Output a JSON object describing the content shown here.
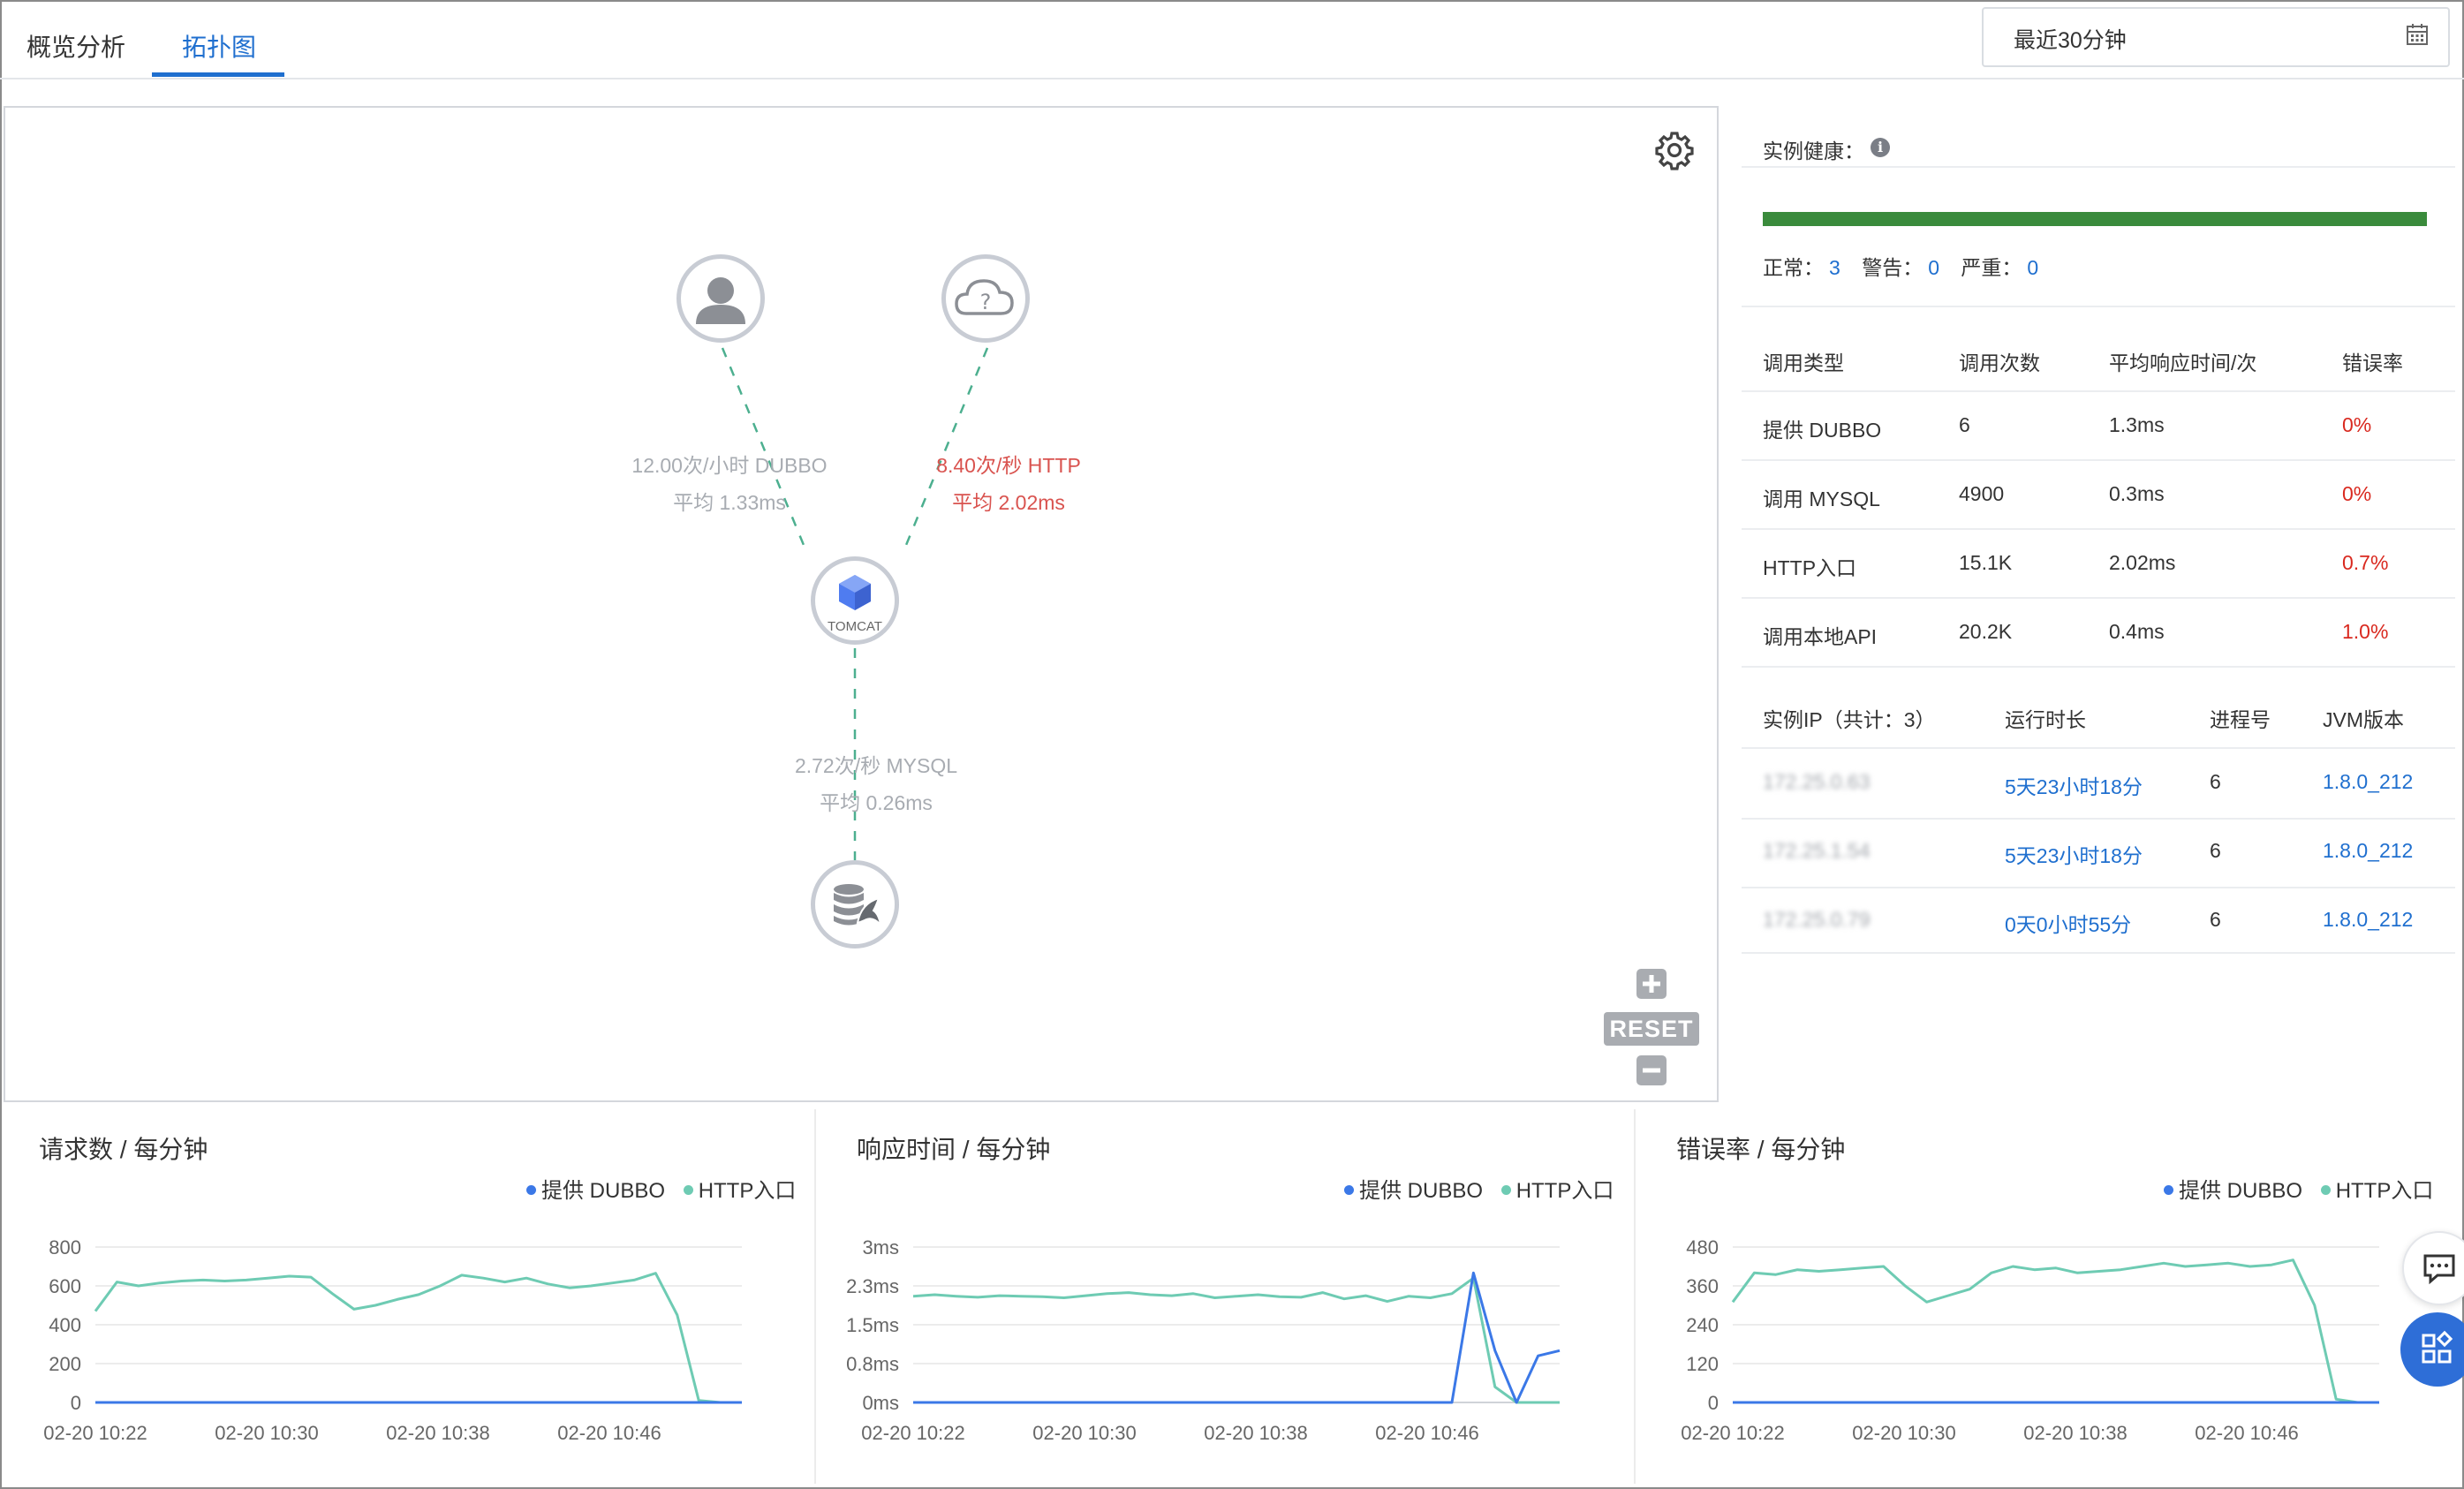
{
  "tabs": [
    {
      "label": "概览分析",
      "active": false
    },
    {
      "label": "拓扑图",
      "active": true
    }
  ],
  "time_range": {
    "value": "最近30分钟",
    "icon": "calendar-icon"
  },
  "topology": {
    "nodes": [
      {
        "name": "user",
        "icon": "user-icon"
      },
      {
        "name": "external-http",
        "icon": "cloud-question-icon"
      },
      {
        "name": "tomcat",
        "icon": "cube-icon",
        "label": "TOMCAT"
      },
      {
        "name": "mysql",
        "icon": "database-icon"
      }
    ],
    "edges": [
      {
        "line1": "12.00次/小时 DUBBO",
        "line2": "平均 1.33ms",
        "color": "#a8acb2"
      },
      {
        "line1": "8.40次/秒 HTTP",
        "line2": "平均 2.02ms",
        "color": "#d9534f"
      },
      {
        "line1": "2.72次/秒 MYSQL",
        "line2": "平均 0.26ms",
        "color": "#a8acb2"
      }
    ],
    "reset_label": "RESET"
  },
  "health": {
    "title": "实例健康：",
    "normal_label": "正常：",
    "normal": "3",
    "warning_label": "警告：",
    "warning": "0",
    "critical_label": "严重：",
    "critical": "0",
    "bar_color": "#3a8b3c"
  },
  "call_table": {
    "headers": [
      "调用类型",
      "调用次数",
      "平均响应时间/次",
      "错误率"
    ],
    "rows": [
      [
        "提供 DUBBO",
        "6",
        "1.3ms",
        "0%"
      ],
      [
        "调用 MYSQL",
        "4900",
        "0.3ms",
        "0%"
      ],
      [
        "HTTP入口",
        "15.1K",
        "2.02ms",
        "0.7%"
      ],
      [
        "调用本地API",
        "20.2K",
        "0.4ms",
        "1.0%"
      ]
    ]
  },
  "instance_table": {
    "headers": [
      "实例IP（共计：3）",
      "运行时长",
      "进程号",
      "JVM版本"
    ],
    "rows": [
      [
        "172.25.0.63",
        "5天23小时18分",
        "6",
        "1.8.0_212"
      ],
      [
        "172.25.1.54",
        "5天23小时18分",
        "6",
        "1.8.0_212"
      ],
      [
        "172.25.0.79",
        "0天0小时55分",
        "6",
        "1.8.0_212"
      ]
    ]
  },
  "chart_data": [
    {
      "type": "line",
      "title": "请求数 / 每分钟",
      "x": [
        "02-20 10:22",
        "02-20 10:30",
        "02-20 10:38",
        "02-20 10:46"
      ],
      "yticks": [
        "0",
        "200",
        "400",
        "600",
        "800"
      ],
      "ylim": [
        0,
        800
      ],
      "series": [
        {
          "name": "提供 DUBBO",
          "color": "#3b78e7",
          "values": [
            0,
            0,
            0,
            0,
            0,
            0,
            0,
            0,
            0,
            0,
            0,
            0,
            0,
            0,
            0,
            0,
            0,
            0,
            0,
            0,
            0,
            0,
            0,
            0,
            0,
            0,
            0,
            0,
            0,
            0,
            0
          ]
        },
        {
          "name": "HTTP入口",
          "color": "#6ecbb3",
          "values": [
            470,
            620,
            600,
            615,
            625,
            630,
            625,
            630,
            640,
            650,
            645,
            560,
            480,
            500,
            530,
            555,
            600,
            655,
            640,
            620,
            640,
            610,
            590,
            600,
            615,
            630,
            665,
            450,
            10,
            0,
            0
          ]
        }
      ]
    },
    {
      "type": "line",
      "title": "响应时间 / 每分钟",
      "x": [
        "02-20 10:22",
        "02-20 10:30",
        "02-20 10:38",
        "02-20 10:46"
      ],
      "yticks": [
        "0ms",
        "0.8ms",
        "1.5ms",
        "2.3ms",
        "3ms"
      ],
      "ylim": [
        0,
        3
      ],
      "series": [
        {
          "name": "提供 DUBBO",
          "color": "#3b78e7",
          "values": [
            0,
            0,
            0,
            0,
            0,
            0,
            0,
            0,
            0,
            0,
            0,
            0,
            0,
            0,
            0,
            0,
            0,
            0,
            0,
            0,
            0,
            0,
            0,
            0,
            0,
            0,
            2.5,
            1.0,
            0,
            0.9,
            1.0
          ]
        },
        {
          "name": "HTTP入口",
          "color": "#6ecbb3",
          "values": [
            2.05,
            2.08,
            2.05,
            2.03,
            2.06,
            2.05,
            2.04,
            2.02,
            2.06,
            2.1,
            2.12,
            2.08,
            2.06,
            2.1,
            2.02,
            2.05,
            2.08,
            2.04,
            2.03,
            2.12,
            2.0,
            2.06,
            1.95,
            2.05,
            2.02,
            2.1,
            2.4,
            0.3,
            0,
            0,
            0
          ]
        }
      ]
    },
    {
      "type": "line",
      "title": "错误率 / 每分钟",
      "x": [
        "02-20 10:22",
        "02-20 10:30",
        "02-20 10:38",
        "02-20 10:46"
      ],
      "yticks": [
        "0",
        "120",
        "240",
        "360",
        "480"
      ],
      "ylim": [
        0,
        480
      ],
      "series": [
        {
          "name": "提供 DUBBO",
          "color": "#3b78e7",
          "values": [
            0,
            0,
            0,
            0,
            0,
            0,
            0,
            0,
            0,
            0,
            0,
            0,
            0,
            0,
            0,
            0,
            0,
            0,
            0,
            0,
            0,
            0,
            0,
            0,
            0,
            0,
            0,
            0,
            0,
            0,
            0
          ]
        },
        {
          "name": "HTTP入口",
          "color": "#6ecbb3",
          "values": [
            310,
            400,
            395,
            410,
            405,
            410,
            415,
            420,
            360,
            310,
            330,
            350,
            400,
            420,
            410,
            415,
            400,
            405,
            410,
            420,
            430,
            420,
            425,
            430,
            420,
            425,
            440,
            300,
            10,
            0,
            0
          ]
        }
      ]
    }
  ]
}
